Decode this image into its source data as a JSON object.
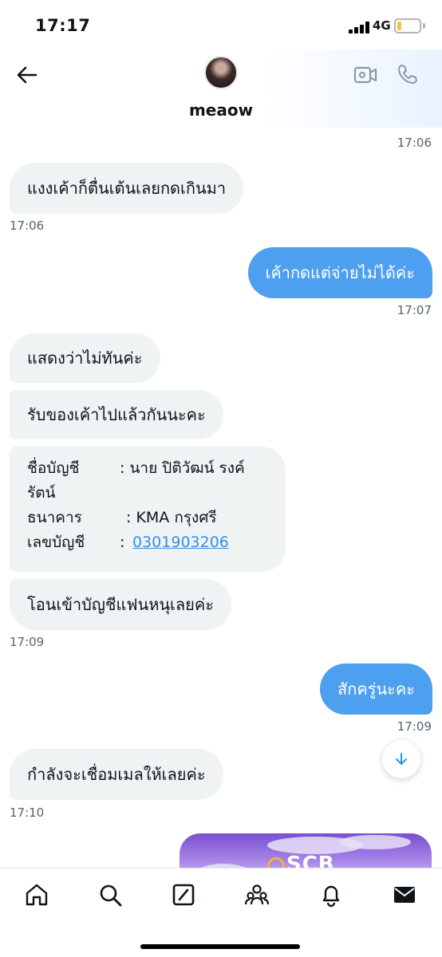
{
  "status_bar": {
    "time": "17:17",
    "network": "4G",
    "battery_level": 0.2
  },
  "header": {
    "contact_name": "meaow"
  },
  "messages": [
    {
      "type": "timestamp",
      "align": "right",
      "text": "17:06"
    },
    {
      "type": "bubble",
      "dir": "in",
      "text": "แงงเค้าก็ตื่นเต้นเลยกดเกินมา"
    },
    {
      "type": "timestamp",
      "align": "left",
      "text": "17:06"
    },
    {
      "type": "bubble",
      "dir": "out",
      "text": "เค้ากดแต่จ่ายไม่ได้ค่ะ"
    },
    {
      "type": "timestamp",
      "align": "right",
      "text": "17:07"
    },
    {
      "type": "bubble",
      "dir": "in",
      "text": "แสดงว่าไม่ทันค่ะ"
    },
    {
      "type": "bubble",
      "dir": "in",
      "text": "รับของเค้าไปแล้วกันนะคะ"
    },
    {
      "type": "account_card",
      "account_name_label": "ชื่อบัญชี",
      "account_name_value": ": นาย ปิติวัฒน์ รงค์",
      "account_name_cont": "รัตน์",
      "bank_label": "ธนาคาร",
      "bank_value": ": KMA  กรุงศรี",
      "account_no_label": "เลขบัญชี",
      "account_no_sep": ":",
      "account_no_value": "0301903206"
    },
    {
      "type": "bubble",
      "dir": "in",
      "text": "โอนเข้าบัญชีแฟนหนุเลยค่ะ"
    },
    {
      "type": "timestamp",
      "align": "left",
      "text": "17:09"
    },
    {
      "type": "bubble",
      "dir": "out",
      "text": "สักครู่นะคะ"
    },
    {
      "type": "timestamp",
      "align": "right",
      "text": "17:09"
    },
    {
      "type": "bubble",
      "dir": "in",
      "text": "กำลังจะเชื่อมเมลให้เลยค่ะ"
    },
    {
      "type": "timestamp",
      "align": "left",
      "text": "17:10"
    }
  ],
  "promo": {
    "text": "SCB"
  },
  "tabbar": [
    "home-icon",
    "search-icon",
    "compose-icon",
    "communities-icon",
    "notifications-icon",
    "messages-icon"
  ],
  "colors": {
    "outgoing": "#4d9ff0",
    "incoming": "#eff3f4",
    "link": "#3a8fe0"
  }
}
